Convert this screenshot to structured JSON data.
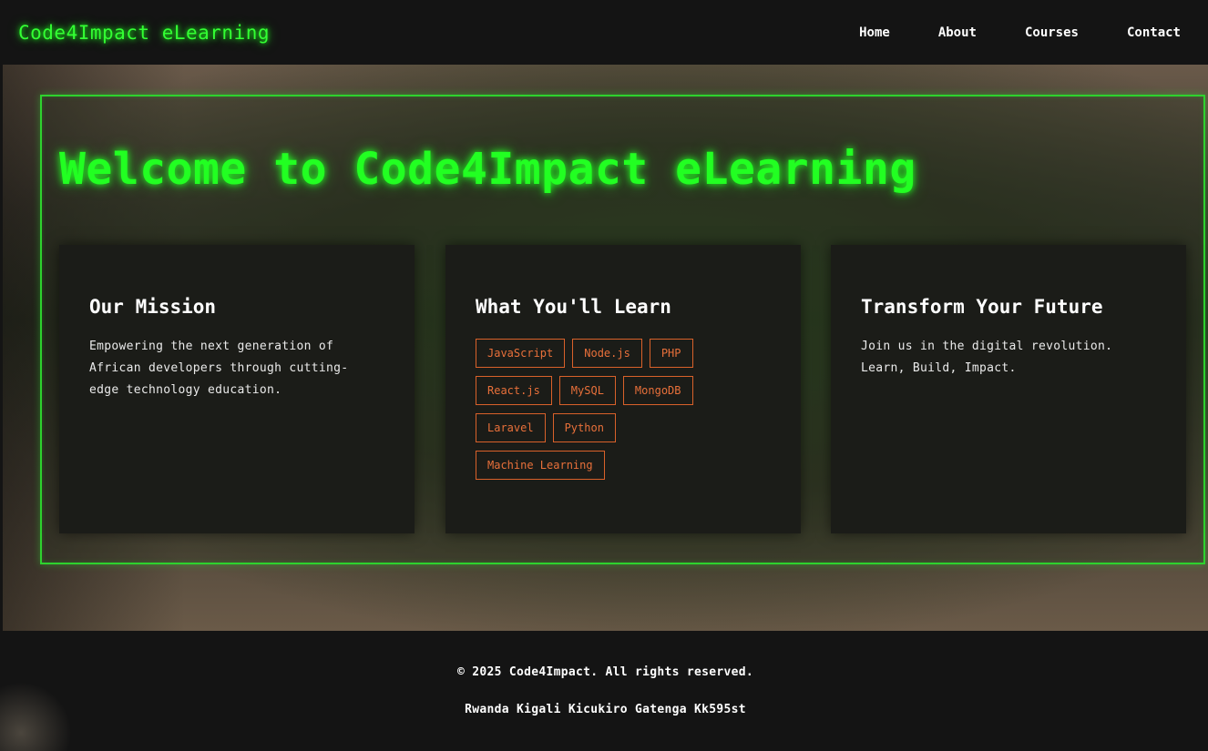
{
  "header": {
    "logo": "Code4Impact eLearning",
    "nav": [
      "Home",
      "About",
      "Courses",
      "Contact"
    ]
  },
  "hero": {
    "title": "Welcome to Code4Impact eLearning",
    "cards": [
      {
        "title": "Our Mission",
        "text": "Empowering the next generation of African developers through cutting-edge technology education."
      },
      {
        "title": "What You'll Learn",
        "tags": [
          "JavaScript",
          "Node.js",
          "PHP",
          "React.js",
          "MySQL",
          "MongoDB",
          "Laravel",
          "Python",
          "Machine Learning"
        ]
      },
      {
        "title": "Transform Your Future",
        "text": "Join us in the digital revolution. Learn, Build, Impact."
      }
    ]
  },
  "footer": {
    "copyright": "© 2025 Code4Impact. All rights reserved.",
    "address": "Rwanda Kigali Kicukiro Gatenga Kk595st"
  },
  "colors": {
    "accent_green": "#22ff22",
    "tag_orange": "#d9612a",
    "background_dark": "#141414"
  }
}
